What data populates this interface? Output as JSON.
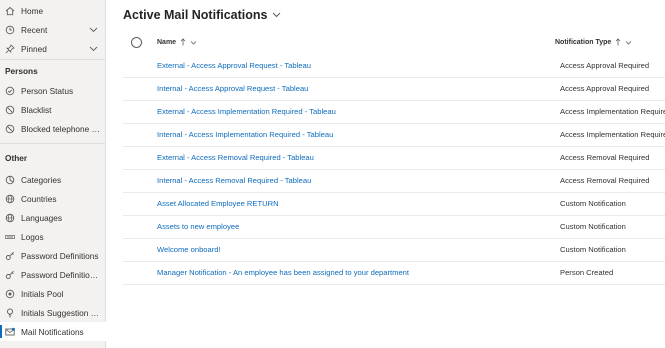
{
  "sidebar": {
    "top_items": [
      {
        "label": "Home",
        "icon": "home-icon"
      },
      {
        "label": "Recent",
        "icon": "clock-icon"
      },
      {
        "label": "Pinned",
        "icon": "pin-icon"
      }
    ],
    "persons_title": "Persons",
    "persons_items": [
      {
        "label": "Person Status",
        "icon": "person-status-icon"
      },
      {
        "label": "Blacklist",
        "icon": "blocked-icon"
      },
      {
        "label": "Blocked telephone n...",
        "icon": "blocked-phone-icon"
      }
    ],
    "other_title": "Other",
    "other_items": [
      {
        "label": "Categories",
        "icon": "categories-icon"
      },
      {
        "label": "Countries",
        "icon": "globe-icon"
      },
      {
        "label": "Languages",
        "icon": "globe-icon"
      },
      {
        "label": "Logos",
        "icon": "logo-icon"
      },
      {
        "label": "Password Definitions",
        "icon": "password-icon"
      },
      {
        "label": "Password Definition ...",
        "icon": "password-icon"
      },
      {
        "label": "Initials Pool",
        "icon": "pool-icon"
      },
      {
        "label": "Initials Suggestion D...",
        "icon": "suggestion-icon"
      },
      {
        "label": "Mail Notifications",
        "icon": "mail-notification-icon",
        "active": true
      }
    ]
  },
  "main": {
    "title": "Active Mail Notifications",
    "columns": {
      "name": "Name",
      "type": "Notification Type"
    },
    "rows": [
      {
        "name": "External - Access Approval Request - Tableau",
        "type": "Access Approval Required"
      },
      {
        "name": "Internal - Access Approval Request - Tableau",
        "type": "Access Approval Required"
      },
      {
        "name": "External - Access Implementation Required - Tableau",
        "type": "Access Implementation Required"
      },
      {
        "name": "Internal - Access Implementation Required - Tableau",
        "type": "Access Implementation Required"
      },
      {
        "name": "External - Access Removal Required - Tableau",
        "type": "Access Removal Required"
      },
      {
        "name": "Internal - Access Removal Required - Tableau",
        "type": "Access Removal Required"
      },
      {
        "name": "Asset Allocated Employee RETURN",
        "type": "Custom Notification"
      },
      {
        "name": "Assets to new employee",
        "type": "Custom Notification"
      },
      {
        "name": "Welcome onboard!",
        "type": "Custom Notification"
      },
      {
        "name": "Manager Notification - An employee has been assigned to your department",
        "type": "Person Created"
      }
    ]
  },
  "colors": {
    "link": "#0f6cbd",
    "sidebar_bg": "#f3f2f1",
    "text": "#323130"
  }
}
